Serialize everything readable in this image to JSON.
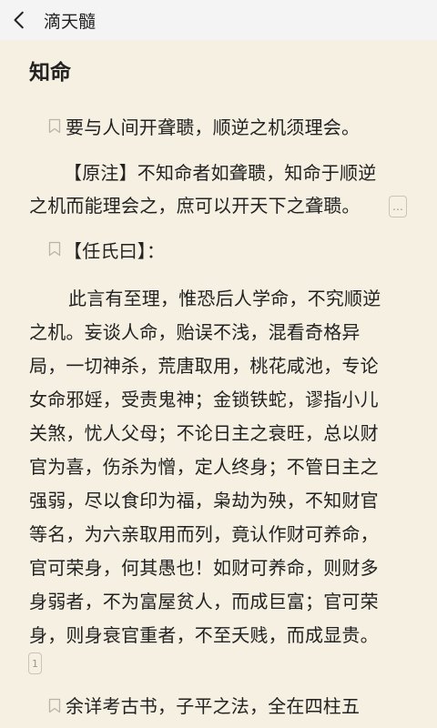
{
  "topbar": {
    "title": "滴天髓"
  },
  "chapter": {
    "title": "知命"
  },
  "verse1": {
    "text": "要与人间开聋聩，顺逆之机须理会。"
  },
  "note1": {
    "line1": "【原注】不知命者如聋聩，知命于顺逆",
    "line2": "之机而能理会之，庶可以开天下之聋聩。",
    "marker": "…"
  },
  "ren": {
    "heading": "【任氏曰】："
  },
  "para": {
    "lines": [
      "此言有至理，惟恐后人学命，不究顺逆",
      "之机。妄谈人命，贻误不浅，混看奇格异",
      "局，一切神杀，荒唐取用，桃花咸池，专论",
      "女命邪婬，受责鬼神；金锁铁蛇，谬指小儿",
      "关煞，忧人父母；不论日主之衰旺，总以财",
      "官为喜，伤杀为憎，定人终身；不管日主之",
      "强弱，尽以食印为福，枭劫为殃，不知财官",
      "等名，为六亲取用而列，竟认作财可养命，",
      "官可荣身，何其愚也！如财可养命，则财多",
      "身弱者，不为富屋贫人，而成巨富；官可荣",
      "身，则身衰官重者，不至夭贱，而成显贵。"
    ],
    "marker": "1"
  },
  "verse2": {
    "text": "余详考古书，子平之法，全在四柱五"
  },
  "icons": {
    "back": "chevron-left-icon",
    "bookmark": "bookmark-icon"
  },
  "colors": {
    "background": "#f5f0e1",
    "topbar": "#f4f4f4",
    "text": "#222222"
  }
}
